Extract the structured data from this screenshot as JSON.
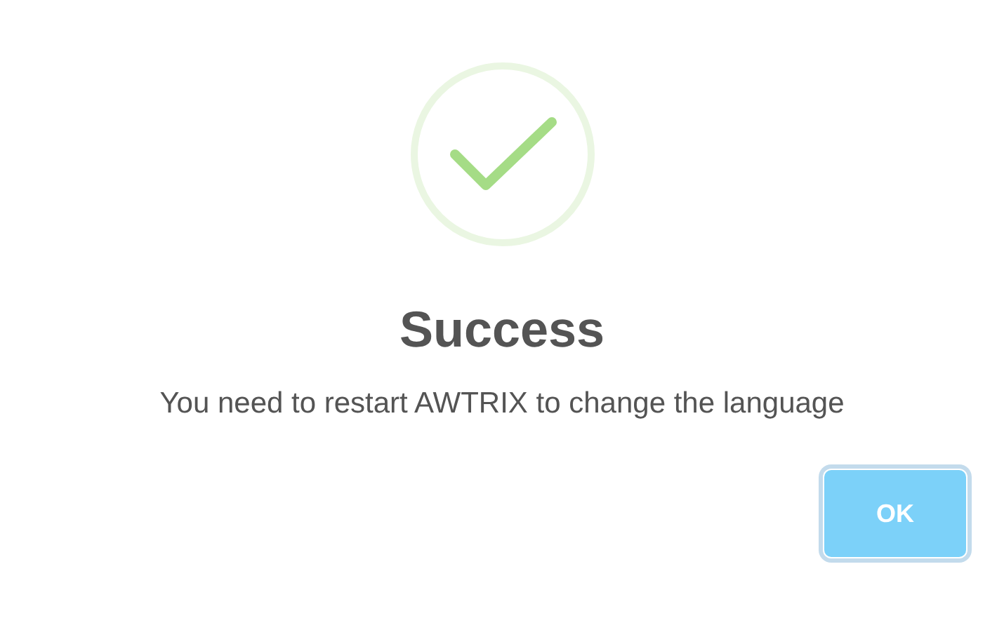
{
  "dialog": {
    "icon": {
      "kind": "success"
    },
    "title": "Success",
    "text": "You need to restart AWTRIX to change the language",
    "buttons": [
      {
        "label": "OK",
        "focused": true
      }
    ]
  }
}
